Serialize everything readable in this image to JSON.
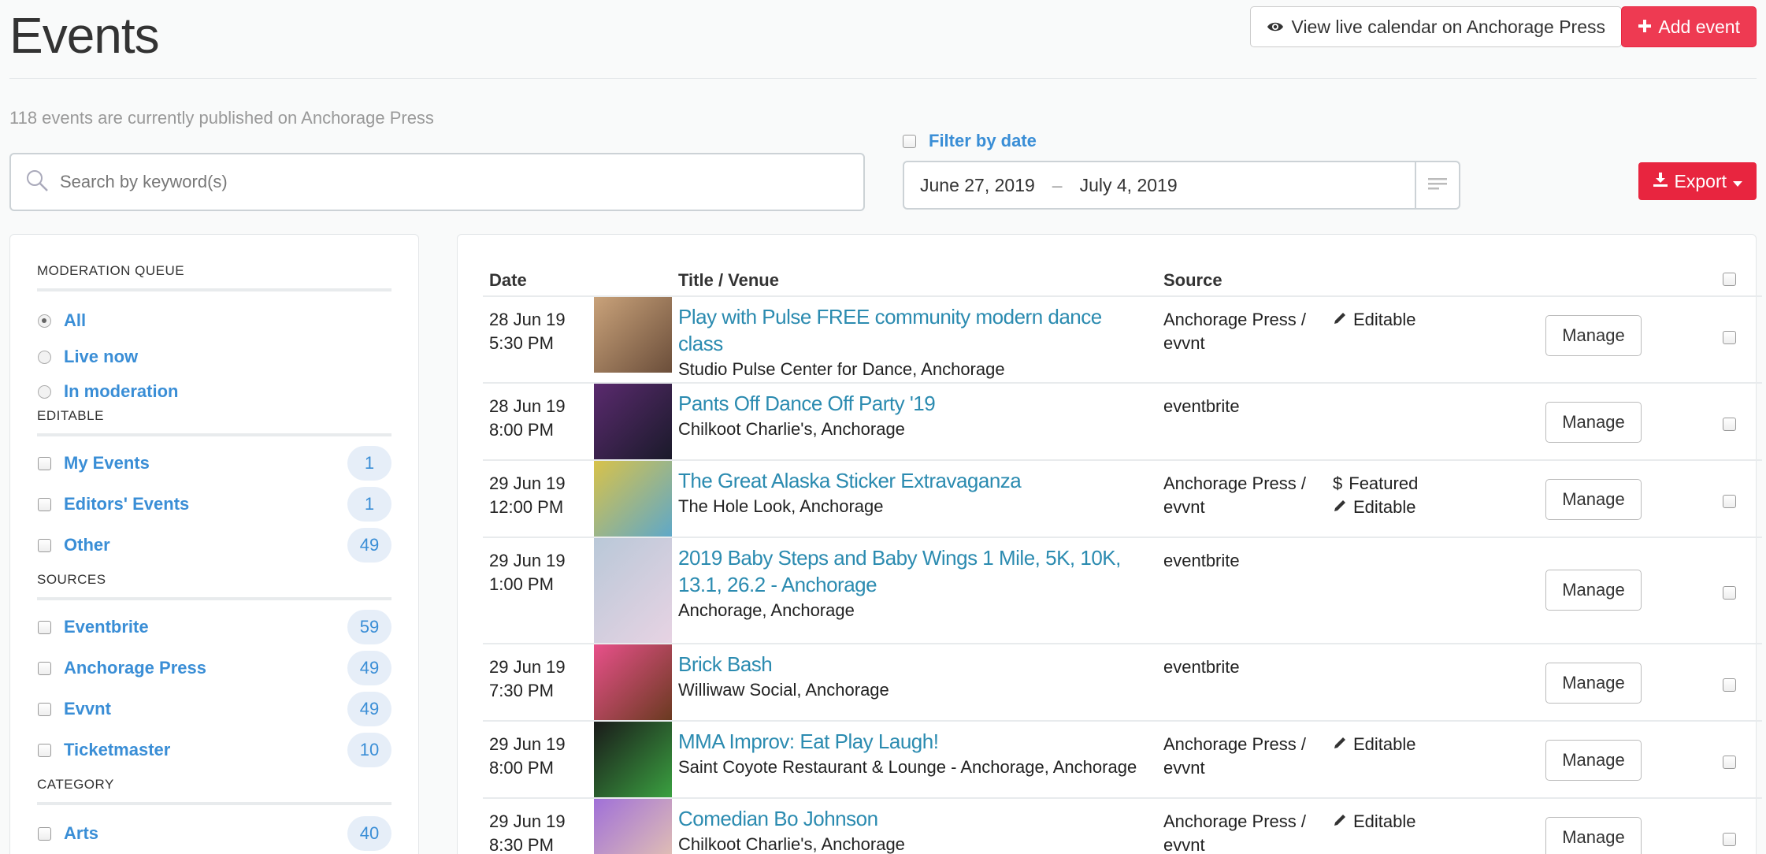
{
  "header": {
    "title": "Events",
    "view_live_label": "View live calendar on Anchorage Press",
    "add_event_label": "Add event"
  },
  "subtitle": "118 events are currently published on Anchorage Press",
  "search": {
    "placeholder": "Search by keyword(s)",
    "value": ""
  },
  "filter": {
    "label": "Filter by date",
    "from": "June 27, 2019",
    "dash": "–",
    "to": "July 4, 2019"
  },
  "export_label": "Export",
  "sidebar": {
    "moderation": {
      "title": "MODERATION QUEUE",
      "items": [
        {
          "label": "All",
          "selected": true
        },
        {
          "label": "Live now",
          "selected": false
        },
        {
          "label": "In moderation",
          "selected": false
        }
      ]
    },
    "editable": {
      "title": "EDITABLE",
      "items": [
        {
          "label": "My Events",
          "count": "1"
        },
        {
          "label": "Editors' Events",
          "count": "1"
        },
        {
          "label": "Other",
          "count": "49"
        }
      ]
    },
    "sources": {
      "title": "SOURCES",
      "items": [
        {
          "label": "Eventbrite",
          "count": "59"
        },
        {
          "label": "Anchorage Press",
          "count": "49"
        },
        {
          "label": "Evvnt",
          "count": "49"
        },
        {
          "label": "Ticketmaster",
          "count": "10"
        }
      ]
    },
    "category": {
      "title": "CATEGORY",
      "items": [
        {
          "label": "Arts",
          "count": "40"
        }
      ]
    }
  },
  "table": {
    "headers": {
      "date": "Date",
      "title": "Title / Venue",
      "source": "Source"
    },
    "manage_label": "Manage",
    "rows": [
      {
        "date": "28 Jun 19",
        "time": "5:30 PM",
        "title": "Play with Pulse FREE community modern dance class",
        "venue": "Studio Pulse Center for Dance, Anchorage",
        "source1": "Anchorage Press /",
        "source2": "evvnt",
        "featured": "",
        "editable": "Editable",
        "thumb_colors": [
          "#c9a27a",
          "#6b4e3a"
        ]
      },
      {
        "date": "28 Jun 19",
        "time": "8:00 PM",
        "title": "Pants Off Dance Off Party '19",
        "venue": "Chilkoot Charlie's, Anchorage",
        "source1": "eventbrite",
        "source2": "",
        "featured": "",
        "editable": "",
        "thumb_colors": [
          "#5a2a6e",
          "#1a1a2a"
        ]
      },
      {
        "date": "29 Jun 19",
        "time": "12:00 PM",
        "title": "The Great Alaska Sticker Extravaganza",
        "venue": "The Hole Look, Anchorage",
        "source1": "Anchorage Press /",
        "source2": "evvnt",
        "featured": "Featured",
        "editable": "Editable",
        "thumb_colors": [
          "#d8c24a",
          "#5fa8c8"
        ]
      },
      {
        "date": "29 Jun 19",
        "time": "1:00 PM",
        "title": "2019 Baby Steps and Baby Wings 1 Mile, 5K, 10K, 13.1, 26.2 - Anchorage",
        "venue": "Anchorage, Anchorage",
        "source1": "eventbrite",
        "source2": "",
        "featured": "",
        "editable": "",
        "thumb_colors": [
          "#b9c8d8",
          "#e7d3e3"
        ]
      },
      {
        "date": "29 Jun 19",
        "time": "7:30 PM",
        "title": "Brick Bash",
        "venue": "Williwaw Social, Anchorage",
        "source1": "eventbrite",
        "source2": "",
        "featured": "",
        "editable": "",
        "thumb_colors": [
          "#e8508a",
          "#6a3a20"
        ]
      },
      {
        "date": "29 Jun 19",
        "time": "8:00 PM",
        "title": "MMA Improv: Eat Play Laugh!",
        "venue": "Saint Coyote Restaurant & Lounge - Anchorage, Anchorage",
        "source1": "Anchorage Press /",
        "source2": "evvnt",
        "featured": "",
        "editable": "Editable",
        "thumb_colors": [
          "#1a1a1a",
          "#3aa040"
        ]
      },
      {
        "date": "29 Jun 19",
        "time": "8:30 PM",
        "title": "Comedian Bo Johnson",
        "venue": "Chilkoot Charlie's, Anchorage",
        "source1": "Anchorage Press /",
        "source2": "evvnt",
        "featured": "",
        "editable": "Editable",
        "thumb_colors": [
          "#a070d8",
          "#e8c8b0"
        ]
      }
    ]
  }
}
